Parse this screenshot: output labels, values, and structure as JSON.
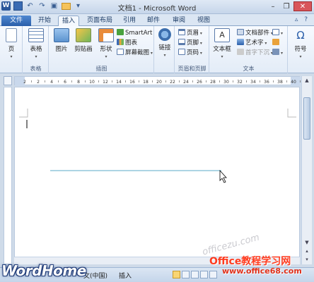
{
  "window": {
    "title": "文档1 - Microsoft Word",
    "app_icon_letter": "W"
  },
  "tabs": {
    "file": "文件",
    "items": [
      "开始",
      "插入",
      "页面布局",
      "引用",
      "邮件",
      "审阅",
      "视图"
    ],
    "active": "插入"
  },
  "ribbon": {
    "pages": {
      "label": "页"
    },
    "tables": {
      "button": "表格",
      "group": "表格"
    },
    "illustrations": {
      "picture": "图片",
      "clipart": "剪贴画",
      "shapes": "形状",
      "smartart": "SmartArt",
      "chart": "图表",
      "screenshot": "屏幕截图",
      "group": "插图"
    },
    "links": {
      "button": "链接"
    },
    "header_footer": {
      "header": "页眉",
      "footer": "页脚",
      "page_number": "页码",
      "group": "页眉和页脚"
    },
    "text": {
      "textbox": "文本框",
      "quickparts": "文档部件",
      "wordart": "艺术字",
      "dropcap": "首字下沉",
      "group": "文本"
    },
    "symbols": {
      "button": "符号"
    }
  },
  "ruler": {
    "ticks": [
      "2",
      "2",
      "4",
      "6",
      "8",
      "10",
      "12",
      "14",
      "16",
      "18",
      "20",
      "22",
      "24",
      "26",
      "28",
      "30",
      "32",
      "34",
      "36",
      "38",
      "40"
    ]
  },
  "status": {
    "language": "文(中国)",
    "mode": "插入"
  },
  "watermarks": {
    "left": "WordHome",
    "right_top": "Office教程学习网",
    "right_bottom": "www.office68.com",
    "faint": "officezu.com"
  }
}
